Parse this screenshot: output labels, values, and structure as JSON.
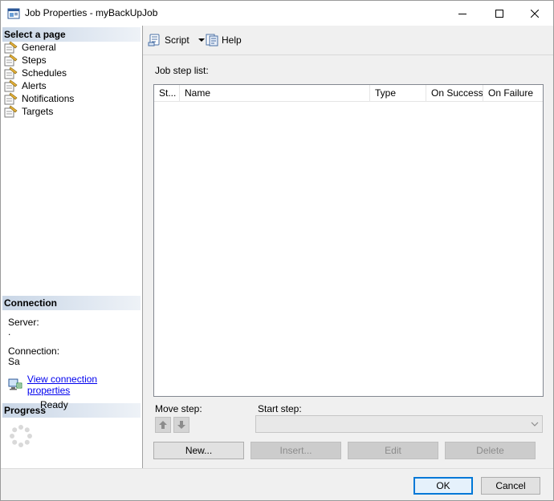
{
  "window": {
    "title": "Job Properties - myBackUpJob"
  },
  "left_pane": {
    "select_page_header": "Select a page",
    "pages": [
      {
        "label": "General"
      },
      {
        "label": "Steps"
      },
      {
        "label": "Schedules"
      },
      {
        "label": "Alerts"
      },
      {
        "label": "Notifications"
      },
      {
        "label": "Targets"
      }
    ],
    "connection_header": "Connection",
    "server_label": "Server:",
    "server_value": ".",
    "connection_label": "Connection:",
    "connection_value": "Sa",
    "view_connection_link": "View connection properties",
    "progress_header": "Progress",
    "progress_status": "Ready"
  },
  "toolbar": {
    "script_label": "Script",
    "help_label": "Help"
  },
  "main": {
    "job_step_list_label": "Job step list:",
    "columns": [
      "St...",
      "Name",
      "Type",
      "On Success",
      "On Failure"
    ],
    "move_step_label": "Move step:",
    "start_step_label": "Start step:",
    "start_step_value": "",
    "buttons": {
      "new": "New...",
      "insert": "Insert...",
      "edit": "Edit",
      "delete": "Delete"
    }
  },
  "footer": {
    "ok": "OK",
    "cancel": "Cancel"
  },
  "colors": {
    "accent": "#0078d7",
    "link": "#0000ee",
    "header_gradient": "#c9d6e6"
  }
}
